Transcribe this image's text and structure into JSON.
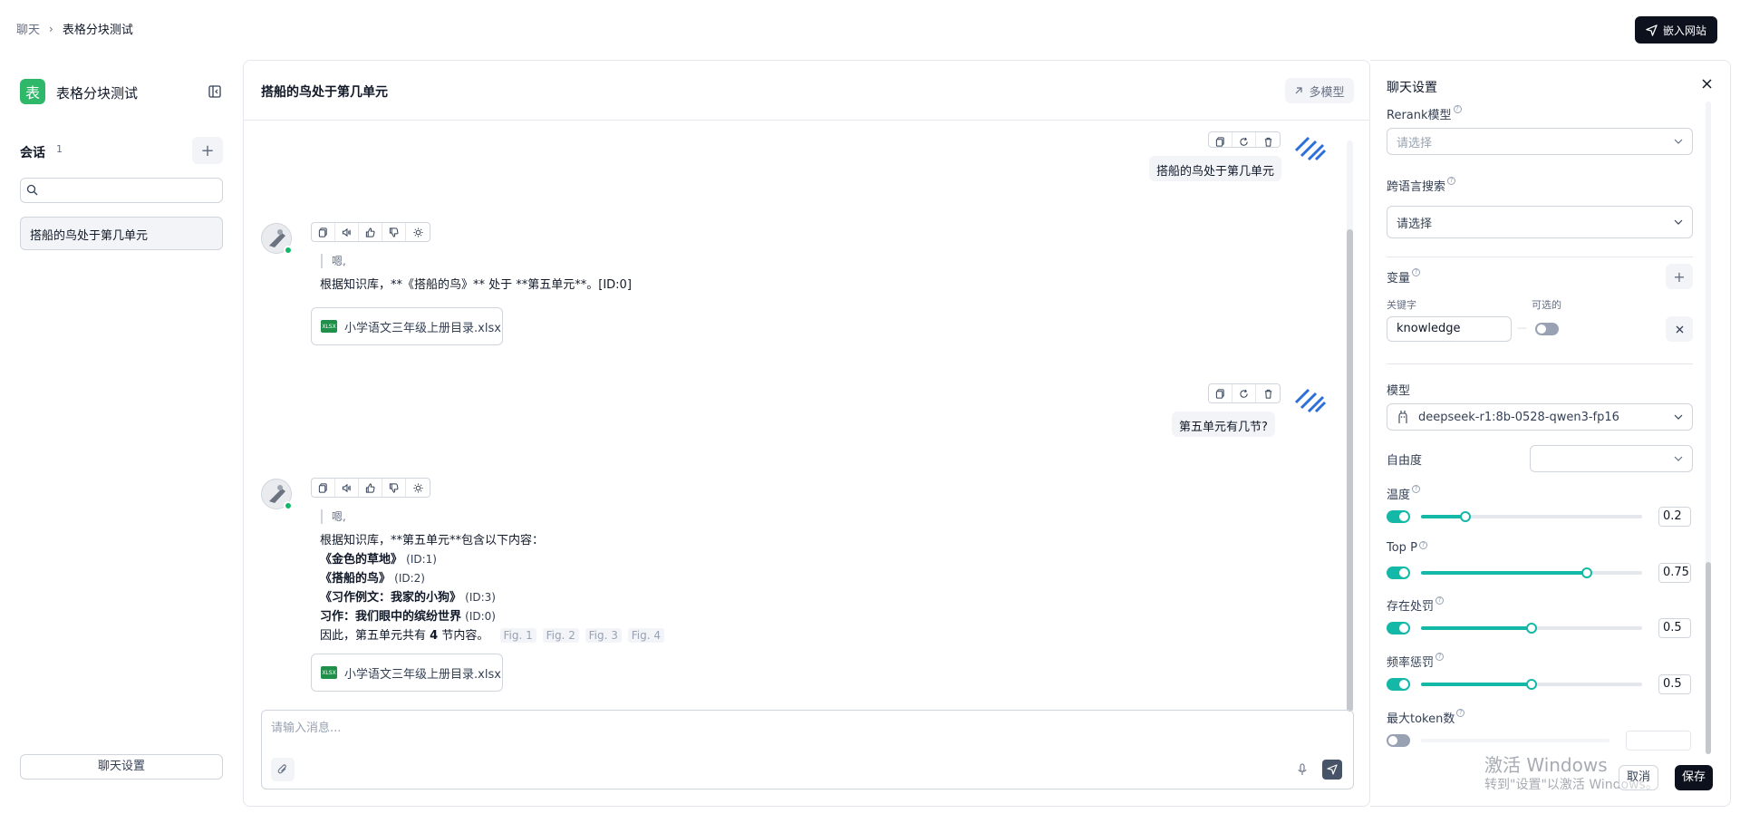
{
  "breadcrumb": {
    "parent": "聊天",
    "separator": "›",
    "current": "表格分块测试"
  },
  "header": {
    "embed_label": "嵌入网站"
  },
  "sidebar": {
    "logo_char": "表",
    "title": "表格分块测试",
    "sessions_label": "会话",
    "sessions_count": "1",
    "add_symbol": "+",
    "search_placeholder": "",
    "sessions": [
      {
        "title": "搭船的鸟处于第几单元"
      }
    ],
    "settings_label": "聊天设置"
  },
  "chat": {
    "title": "搭船的鸟处于第几单元",
    "multi_model_label": "多模型",
    "messages": [
      {
        "role": "user",
        "text": "搭船的鸟处于第几单元"
      },
      {
        "role": "assistant",
        "think": "嗯,",
        "text": "根据知识库，**《搭船的鸟》** 处于 **第五单元**。[ID:0]",
        "file": "小学语文三年级上册目录.xlsx"
      },
      {
        "role": "user",
        "text": "第五单元有几节?"
      },
      {
        "role": "assistant",
        "think": "嗯,",
        "lines": [
          "根据知识库，**第五单元**包含以下内容：",
          "《金色的草地》",
          "(ID:1)",
          "《搭船的鸟》",
          "(ID:2)",
          "《习作例文：我家的小狗》",
          "(ID:3)",
          "习作：我们眼中的缤纷世界",
          "(ID:0)",
          "因此，第五单元共有",
          "4",
          "节内容。"
        ],
        "figs": [
          "Fig. 1",
          "Fig. 2",
          "Fig. 3",
          "Fig. 4"
        ],
        "file": "小学语文三年级上册目录.xlsx"
      }
    ],
    "input_placeholder": "请输入消息..."
  },
  "settings": {
    "title": "聊天设置",
    "rerank_label": "Rerank模型",
    "rerank_placeholder": "请选择",
    "cross_lang_label": "跨语言搜索",
    "cross_lang_placeholder": "请选择",
    "variables_label": "变量",
    "keyword_label": "关键字",
    "optional_label": "可选的",
    "variable_value": "knowledge",
    "dash": "—",
    "model_label": "模型",
    "model_value": "deepseek-r1:8b-0528-qwen3-fp16",
    "freedom_label": "自由度",
    "freedom_value": "",
    "params": [
      {
        "label": "温度",
        "value": "0.2",
        "enabled": true,
        "level": 0.2
      },
      {
        "label": "Top P",
        "value": "0.75",
        "enabled": true,
        "level": 0.75
      },
      {
        "label": "存在处罚",
        "value": "0.5",
        "enabled": true,
        "level": 0.5
      },
      {
        "label": "频率惩罚",
        "value": "0.5",
        "enabled": true,
        "level": 0.5
      },
      {
        "label": "最大token数",
        "value": "",
        "enabled": false,
        "level": 0
      }
    ],
    "cancel_label": "取消",
    "save_label": "保存"
  },
  "watermark": {
    "line1": "激活 Windows",
    "line2": "转到\"设置\"以激活 Windows。"
  },
  "colors": {
    "accent": "#14b8a6",
    "primary_dark": "#0c111d",
    "online": "#12b76a",
    "logo": "#2fb86a"
  }
}
